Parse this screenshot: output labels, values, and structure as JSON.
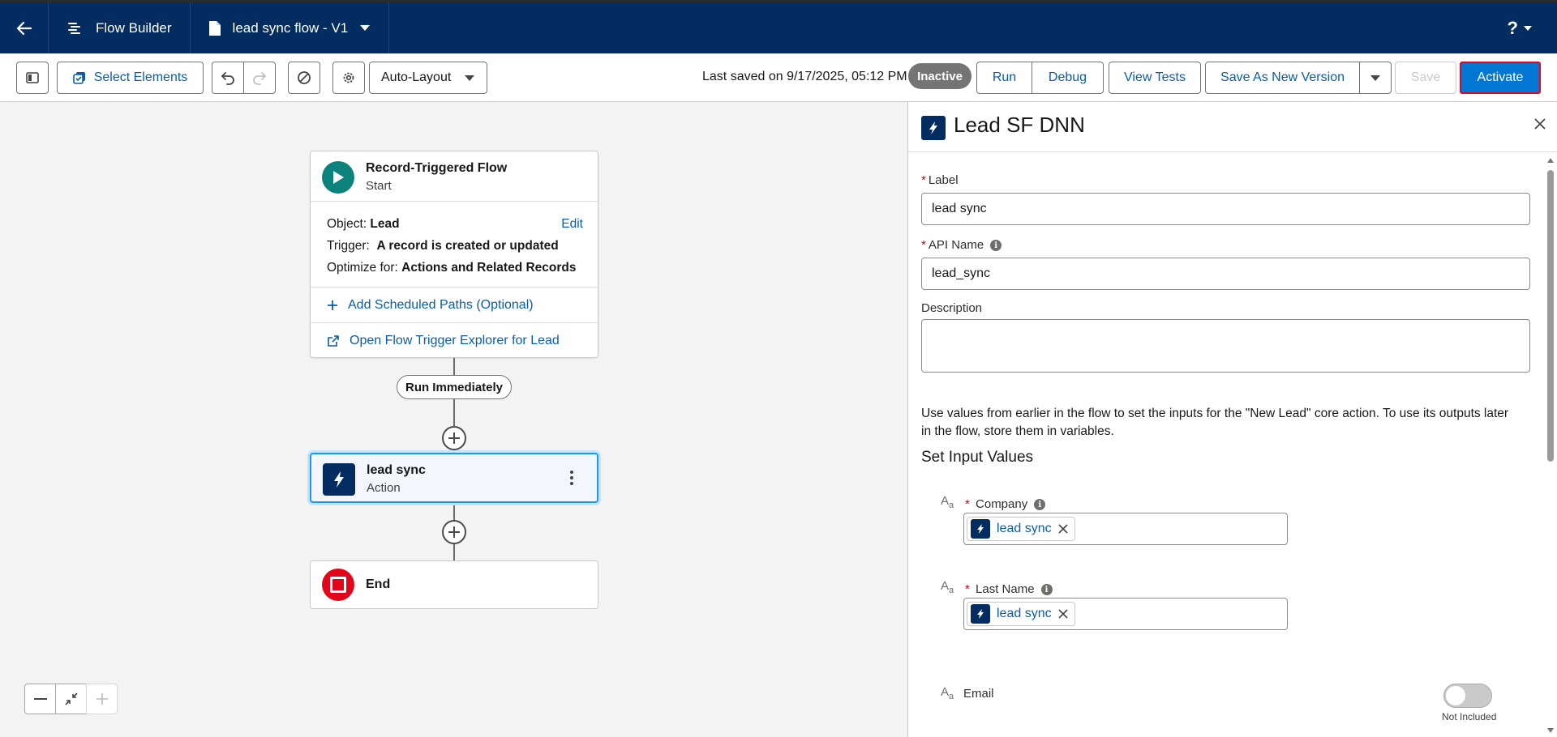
{
  "header": {
    "app_name": "Flow Builder",
    "flow_name": "lead sync flow - V1",
    "help_label": "?"
  },
  "toolbar": {
    "select_elements_label": "Select Elements",
    "layout_selected": "Auto-Layout",
    "last_saved": "Last saved on 9/17/2025, 05:12 PM",
    "status_badge": "Inactive",
    "run_label": "Run",
    "debug_label": "Debug",
    "view_tests_label": "View Tests",
    "save_as_new_version_label": "Save As New Version",
    "save_label": "Save",
    "activate_label": "Activate"
  },
  "canvas": {
    "start": {
      "title": "Record-Triggered Flow",
      "subtitle": "Start",
      "object_label": "Object:",
      "object_value": "Lead",
      "edit_label": "Edit",
      "trigger_label": "Trigger:",
      "trigger_value": "A record is created or updated",
      "optimize_label": "Optimize for:",
      "optimize_value": "Actions and Related Records",
      "add_scheduled_paths": "Add Scheduled Paths (Optional)",
      "open_trigger_explorer": "Open Flow Trigger Explorer for Lead"
    },
    "path_label": "Run Immediately",
    "action": {
      "title": "lead sync",
      "subtitle": "Action"
    },
    "end": {
      "title": "End"
    }
  },
  "panel": {
    "title": "Lead SF DNN",
    "label_field": {
      "label": "Label",
      "value": "lead sync"
    },
    "api_name_field": {
      "label": "API Name",
      "value": "lead_sync"
    },
    "description_field": {
      "label": "Description",
      "value": ""
    },
    "help_text": "Use values from earlier in the flow to set the inputs for the \"New Lead\" core action. To use its outputs later in the flow, store them in variables.",
    "section_title": "Set Input Values",
    "inputs": [
      {
        "label": "Company",
        "required": true,
        "value": "lead sync"
      },
      {
        "label": "Last Name",
        "required": true,
        "value": "lead sync"
      },
      {
        "label": "Email",
        "required": false,
        "toggle_label": "Not Included",
        "toggle_on": false
      }
    ]
  },
  "colors": {
    "header_bg": "#032d60",
    "brand_blue": "#0176d3",
    "link_blue": "#0b5cab",
    "start_green": "#0b827c",
    "end_red": "#e3061b"
  }
}
